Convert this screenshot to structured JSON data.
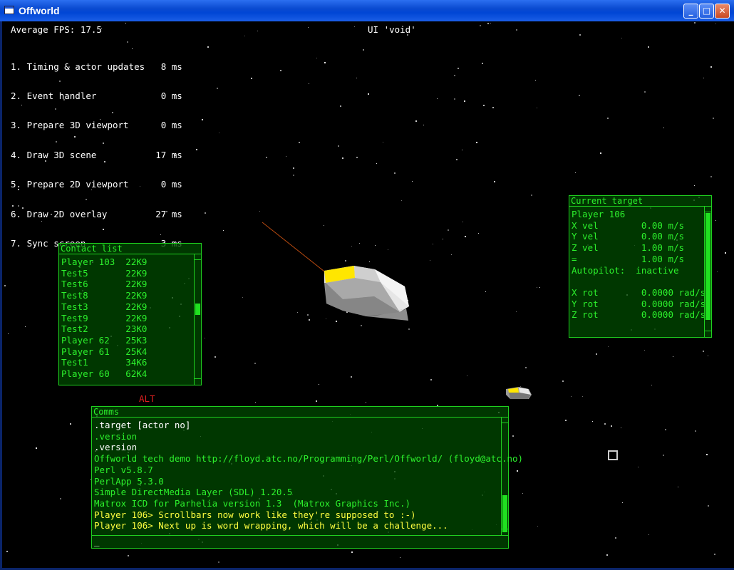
{
  "window": {
    "title": "Offworld"
  },
  "stats": {
    "fps": "Average FPS: 17.5",
    "ui": "UI 'void'",
    "timings": [
      "1. Timing & actor updates   8 ms",
      "2. Event handler            0 ms",
      "3. Prepare 3D viewport      0 ms",
      "4. Draw 3D scene           17 ms",
      "5. Prepare 2D viewport      0 ms",
      "6. Draw 2D overlay         27 ms",
      "7. Sync screen              3 ms"
    ]
  },
  "contact_list": {
    "title": "Contact list",
    "rows": [
      "Player 103  22K9",
      "Test5       22K9",
      "Test6       22K9",
      "Test8       22K9",
      "Test3       22K9",
      "Test9       22K9",
      "Test2       23K0",
      "Player 62   25K3",
      "Player 61   25K4",
      "Test1       34K6",
      "Player 60   62K4"
    ]
  },
  "target": {
    "title": "Current target",
    "rows": [
      "Player 106",
      "X vel        0.00 m/s",
      "Y vel        0.00 m/s",
      "Z vel        1.00 m/s",
      "=            1.00 m/s",
      "Autopilot:  inactive",
      "",
      "X rot        0.0000 rad/s",
      "Y rot        0.0000 rad/s",
      "Z rot        0.0000 rad/s"
    ]
  },
  "alt_label": "ALT",
  "comms": {
    "title": "Comms",
    "lines": [
      {
        "text": ".target [actor no]",
        "color": "#ffffff"
      },
      {
        "text": ".version",
        "color": "#2cf02c"
      },
      {
        "text": ".version",
        "color": "#ffffff"
      },
      {
        "text": "Offworld tech demo http://floyd.atc.no/Programming/Perl/Offworld/ (floyd@atc.no)",
        "color": "#2cf02c"
      },
      {
        "text": "Perl v5.8.7",
        "color": "#2cf02c"
      },
      {
        "text": "PerlApp 5.3.0",
        "color": "#2cf02c"
      },
      {
        "text": "Simple DirectMedia Layer (SDL) 1.20.5",
        "color": "#2cf02c"
      },
      {
        "text": "Matrox ICD for Parhelia version 1.3  (Matrox Graphics Inc.)",
        "color": "#2cf02c"
      },
      {
        "text": "Player 106> Scrollbars now work like they're supposed to :-)",
        "color": "#ffff40"
      },
      {
        "text": "Player 106> Next up is word wrapping, which will be a challenge...",
        "color": "#ffff40"
      }
    ],
    "input_value": "_"
  },
  "colors": {
    "panel_border": "#1fd01f",
    "panel_text": "#2cf02c",
    "alt": "#e02020",
    "highlight": "#ffd400"
  }
}
